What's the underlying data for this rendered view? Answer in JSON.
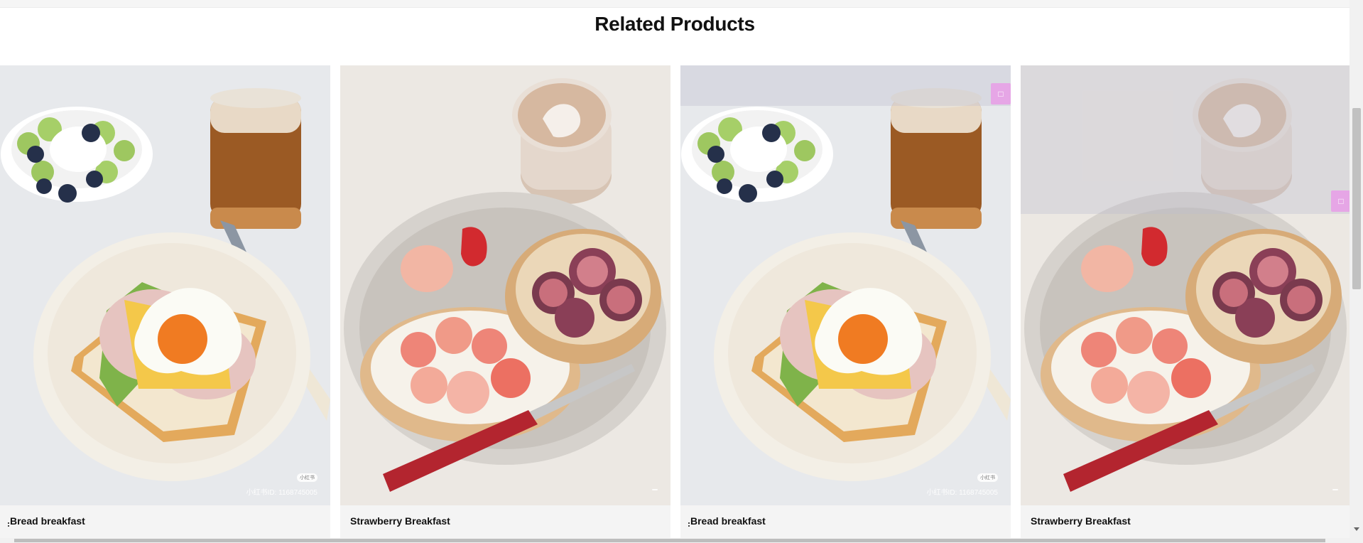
{
  "section": {
    "title": "Related Products"
  },
  "products": [
    {
      "name": "Bread breakfast",
      "watermark_id": "小红书ID: 1168745005",
      "watermark_badge": "小红书"
    },
    {
      "name": "Strawberry Breakfast",
      "watermark_id": "",
      "watermark_badge": ""
    },
    {
      "name": "Bread breakfast",
      "watermark_id": "小红书ID: 1168745005",
      "watermark_badge": "小红书"
    },
    {
      "name": "Strawberry Breakfast",
      "watermark_id": "",
      "watermark_badge": ""
    }
  ],
  "icons": {
    "card_overlay_button": "square-icon",
    "scroll_arrow": "arrow-down-icon",
    "menu_dots": "dots-icon"
  },
  "colors": {
    "accent_pink": "#e6a6e6",
    "card_background": "#f4f4f4"
  }
}
